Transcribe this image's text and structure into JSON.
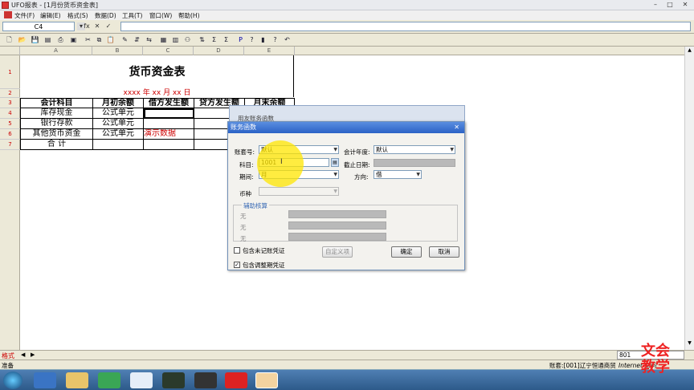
{
  "window": {
    "title": "UFO报表 - [1月份货币资金表]",
    "min": "–",
    "max": "□",
    "close": "✕"
  },
  "menu": [
    "文件(F)",
    "编辑(E)",
    "格式(S)",
    "数据(D)",
    "工具(T)",
    "窗口(W)",
    "帮助(H)"
  ],
  "formula": {
    "cellref": "C4",
    "fx": "fx",
    "cancel": "✕",
    "ok": "✓",
    "value": ""
  },
  "sheet": {
    "cols": [
      "A",
      "B",
      "C",
      "D",
      "E"
    ],
    "rows": [
      "1",
      "2",
      "3",
      "4",
      "5",
      "6",
      "7"
    ],
    "title": "货币资金表",
    "date": "xxxx 年 xx 月 xx 日",
    "headers": [
      "会计科目",
      "月初余额",
      "借方发生额",
      "贷方发生额",
      "月末余额"
    ],
    "items": [
      "库存现金",
      "银行存款",
      "其他货币资金",
      "合  计"
    ],
    "formula_cells": [
      "公式单元",
      "公式单元",
      "公式单元"
    ],
    "demo_text": "演示数据"
  },
  "sheet_tabs": {
    "mode": "格式"
  },
  "status": {
    "left": "准备",
    "account": "账套:[001]辽宁恒通商贸",
    "zoom": "801",
    "net": "Internet 访问"
  },
  "dialog_back_title": "用友账务函数",
  "dialog": {
    "title": "账务函数",
    "close": "✕",
    "acct_label": "账套号:",
    "acct_value": "默认",
    "year_label": "会计年度:",
    "year_value": "默认",
    "subject_label": "科目:",
    "subject_value": "1001",
    "cutoff_label": "截止日期:",
    "period_label": "期间:",
    "period_value": "月",
    "direction_label": "方向:",
    "direction_value": "借",
    "currency_label": "币种",
    "aux_label": "辅助核算",
    "aux_rows": [
      "无",
      "无",
      "无"
    ],
    "chk_unposted": "包含未记账凭证",
    "chk_adjust": "包含调整期凭证",
    "custom_btn": "自定义项",
    "ok_btn": "确定",
    "cancel_btn": "取消"
  },
  "watermark": [
    "文会",
    "教学"
  ]
}
